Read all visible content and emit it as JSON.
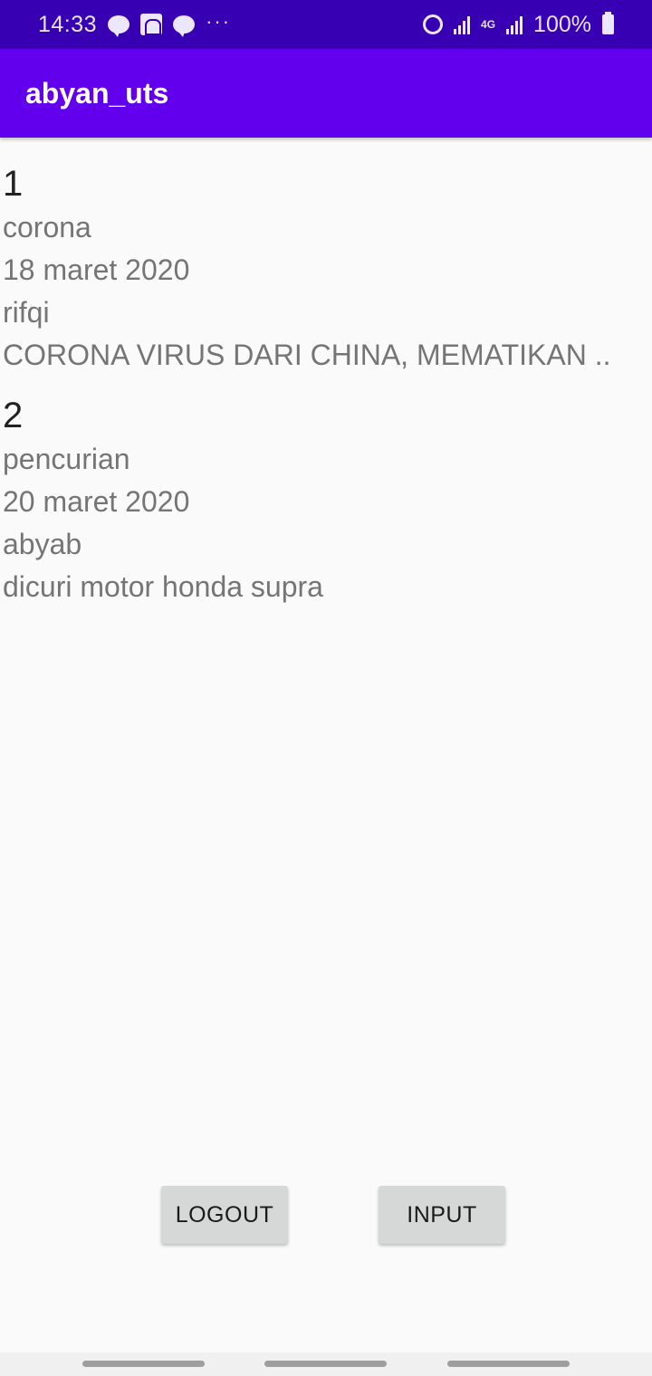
{
  "status_bar": {
    "time": "14:33",
    "left_icons": [
      "line-icon",
      "mosque-icon",
      "line-icon"
    ],
    "more": "···",
    "network_label": "4G",
    "battery": "100%"
  },
  "app_bar": {
    "title": "abyan_uts"
  },
  "entries": [
    {
      "id": "1",
      "title": "corona",
      "date": "18 maret 2020",
      "author": "rifqi",
      "content": "CORONA VIRUS DARI CHINA, MEMATIKAN .."
    },
    {
      "id": "2",
      "title": "pencurian",
      "date": "20 maret 2020",
      "author": "abyab",
      "content": "dicuri motor honda supra"
    }
  ],
  "buttons": {
    "logout": "LOGOUT",
    "input": "INPUT"
  },
  "colors": {
    "status_bar": "#3700b3",
    "app_bar": "#6200ee",
    "button": "#d6d7d7"
  }
}
